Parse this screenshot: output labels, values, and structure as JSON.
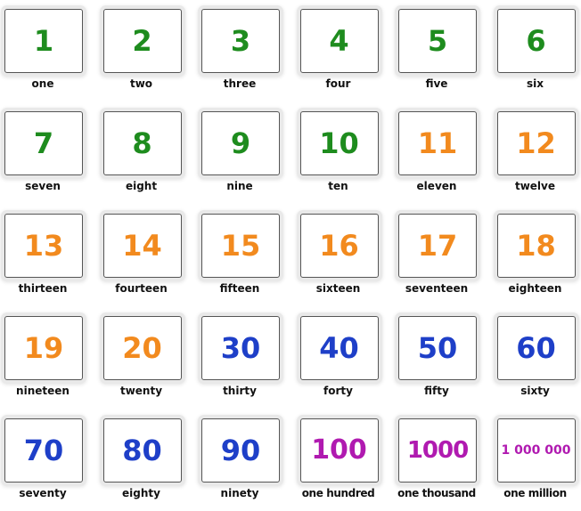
{
  "colors": {
    "green": "#1e8c1e",
    "orange": "#f28a1e",
    "blue": "#1e3fc8",
    "purple": "#b01ab0"
  },
  "cards": [
    {
      "numeral": "1",
      "word": "one",
      "color": "green"
    },
    {
      "numeral": "2",
      "word": "two",
      "color": "green"
    },
    {
      "numeral": "3",
      "word": "three",
      "color": "green"
    },
    {
      "numeral": "4",
      "word": "four",
      "color": "green"
    },
    {
      "numeral": "5",
      "word": "five",
      "color": "green"
    },
    {
      "numeral": "6",
      "word": "six",
      "color": "green"
    },
    {
      "numeral": "7",
      "word": "seven",
      "color": "green"
    },
    {
      "numeral": "8",
      "word": "eight",
      "color": "green"
    },
    {
      "numeral": "9",
      "word": "nine",
      "color": "green"
    },
    {
      "numeral": "10",
      "word": "ten",
      "color": "green"
    },
    {
      "numeral": "11",
      "word": "eleven",
      "color": "orange"
    },
    {
      "numeral": "12",
      "word": "twelve",
      "color": "orange"
    },
    {
      "numeral": "13",
      "word": "thirteen",
      "color": "orange"
    },
    {
      "numeral": "14",
      "word": "fourteen",
      "color": "orange"
    },
    {
      "numeral": "15",
      "word": "fifteen",
      "color": "orange"
    },
    {
      "numeral": "16",
      "word": "sixteen",
      "color": "orange"
    },
    {
      "numeral": "17",
      "word": "seventeen",
      "color": "orange"
    },
    {
      "numeral": "18",
      "word": "eighteen",
      "color": "orange"
    },
    {
      "numeral": "19",
      "word": "nineteen",
      "color": "orange"
    },
    {
      "numeral": "20",
      "word": "twenty",
      "color": "orange"
    },
    {
      "numeral": "30",
      "word": "thirty",
      "color": "blue"
    },
    {
      "numeral": "40",
      "word": "forty",
      "color": "blue"
    },
    {
      "numeral": "50",
      "word": "fifty",
      "color": "blue"
    },
    {
      "numeral": "60",
      "word": "sixty",
      "color": "blue"
    },
    {
      "numeral": "70",
      "word": "seventy",
      "color": "blue"
    },
    {
      "numeral": "80",
      "word": "eighty",
      "color": "blue"
    },
    {
      "numeral": "90",
      "word": "ninety",
      "color": "blue"
    },
    {
      "numeral": "100",
      "word": "one hundred",
      "color": "purple"
    },
    {
      "numeral": "1000",
      "word": "one thousand",
      "color": "purple"
    },
    {
      "numeral": "1 000 000",
      "word": "one million",
      "color": "purple"
    }
  ]
}
